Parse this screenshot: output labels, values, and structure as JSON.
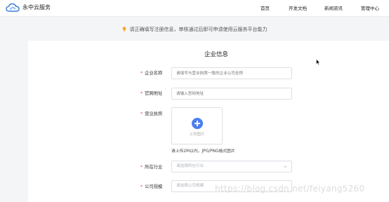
{
  "header": {
    "brand": "永中云服务",
    "nav": [
      "首页",
      "开发文档",
      "新闻资讯",
      "管理中心"
    ]
  },
  "notice": "请正确填写注册信息，审核通过后即可申请使用云服务平台能力",
  "form": {
    "title": "企业信息",
    "required_mark": "*",
    "company_name": {
      "label": "企业名称",
      "placeholder": "请填写与营业执照一致的企业公司全称"
    },
    "website": {
      "label": "官网地址",
      "placeholder": "请输入官网地址"
    },
    "license": {
      "label": "营业执照",
      "upload_text": "上传图片",
      "hint": "请上传2M以内，JPG/PNG格式图片"
    },
    "industry": {
      "label": "所在行业",
      "placeholder": "请选择所在行业"
    },
    "scale": {
      "label": "公司规模",
      "placeholder": "请选择公司规模"
    }
  },
  "watermark": "https://blog.csdn.net/feiyang5260",
  "colors": {
    "accent": "#4c7ef0",
    "required": "#e05252",
    "notice_icon": "#f5a623"
  }
}
